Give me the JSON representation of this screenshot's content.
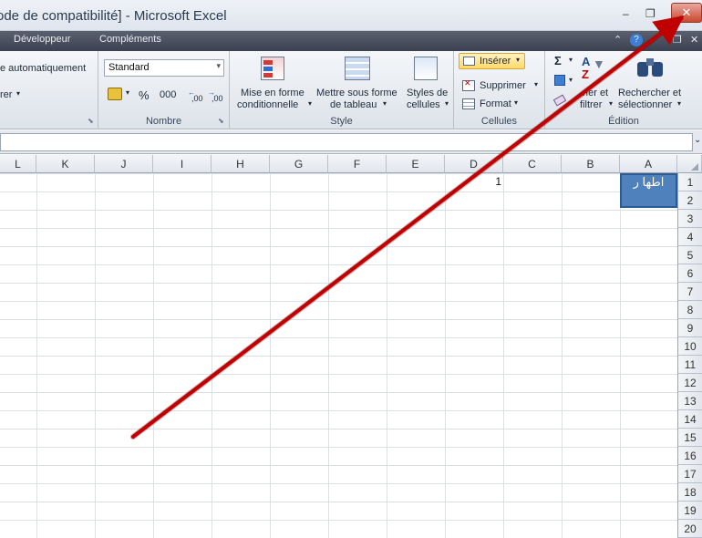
{
  "window": {
    "title": "ode de compatibilité] - Microsoft Excel",
    "minimize": "–",
    "restore": "❐",
    "close": "✕"
  },
  "tabs": [
    "Développeur",
    "Compléments"
  ],
  "ribbon": {
    "alignment": {
      "wrap_text": "e automatiquement",
      "merge": "rer"
    },
    "number": {
      "format_value": "Standard",
      "percent": "%",
      "thousands": "000",
      "inc_decimal": ",00",
      "dec_decimal": ",00",
      "label": "Nombre"
    },
    "style": {
      "conditional": [
        "Mise en forme",
        "conditionnelle"
      ],
      "table": [
        "Mettre sous forme",
        "de tableau"
      ],
      "cell_styles": [
        "Styles de",
        "cellules"
      ],
      "label": "Style"
    },
    "cells": {
      "insert": "Insérer",
      "delete": "Supprimer",
      "format": "Format",
      "label": "Cellules"
    },
    "editing": {
      "sigma": "Σ",
      "sort": [
        "rier et",
        "filtrer"
      ],
      "find": [
        "Rechercher et",
        "sélectionner"
      ],
      "label": "Édition"
    }
  },
  "columns": [
    "L",
    "K",
    "J",
    "I",
    "H",
    "G",
    "F",
    "E",
    "D",
    "C",
    "B",
    "A"
  ],
  "rows": [
    "1",
    "2",
    "3",
    "4",
    "5",
    "6",
    "7",
    "8",
    "9",
    "10",
    "11",
    "12",
    "13",
    "14",
    "15",
    "16",
    "17",
    "18",
    "19",
    "20"
  ],
  "cells": {
    "A1": "اطها ر",
    "D1": "1"
  },
  "colors": {
    "accent": "#4f81bd",
    "annotation_arrow": "#c00000"
  }
}
